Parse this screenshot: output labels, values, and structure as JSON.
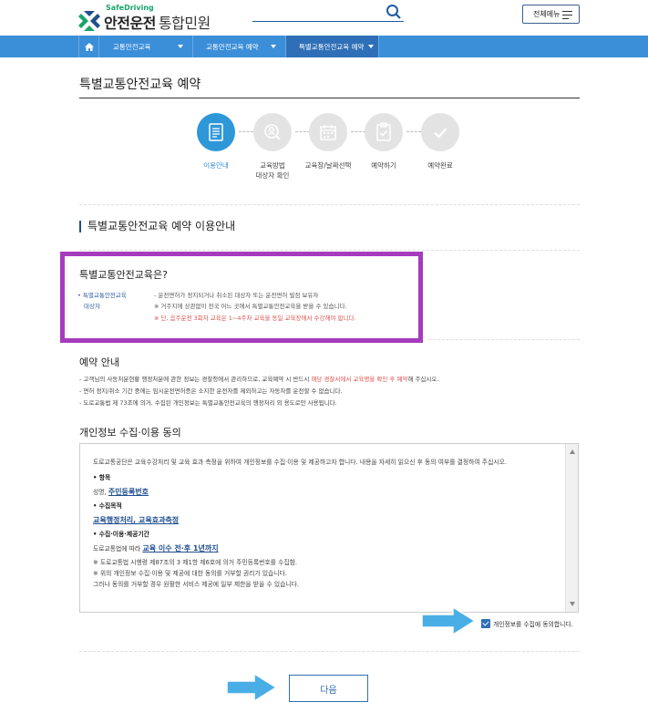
{
  "header": {
    "logo_en": "SafeDriving",
    "logo_ko": "안전운전",
    "logo_sub": "통합민원",
    "all_menu_label": "전체메뉴"
  },
  "nav": {
    "items": [
      {
        "label": "교통안전교육"
      },
      {
        "label": "교통안전교육 예약"
      },
      {
        "label": "특별교통안전교육 예약"
      }
    ]
  },
  "page": {
    "title": "특별교통안전교육 예약"
  },
  "steps": [
    {
      "label": "이용안내",
      "active": true,
      "icon": "document-icon"
    },
    {
      "label": "교육방법\n대상자 확인",
      "active": false,
      "icon": "user-search-icon"
    },
    {
      "label": "교육장/날짜선택",
      "active": false,
      "icon": "calendar-icon"
    },
    {
      "label": "예약하기",
      "active": false,
      "icon": "clipboard-check-icon"
    },
    {
      "label": "예약완료",
      "active": false,
      "icon": "check-icon"
    }
  ],
  "section": {
    "title": "특별교통안전교육 예약 이용안내"
  },
  "about": {
    "title": "특별교통안전교육은?",
    "key_line1": "• 특별교통안전교육",
    "key_line2": "대상자",
    "line1": "- 운전면허가 정지되거나 취소된 대상자 또는 운전면허 벌점 보유자",
    "line2": "※ 거주지에 상관없이 전국 어느 곳에서 특별교통안전교육을 받을 수 있습니다.",
    "line3": "※ 단, 음주운전 3회차 교육은 1~4주차 교육을 동일 교육장에서 수강해야 합니다."
  },
  "reservation": {
    "title": "예약 안내",
    "note1_a": "- 고객님의 사동처분현황 행정처분에 관한 정보는 경찰청에서 관리하므로, 교육예약 시 반드시 ",
    "note1_red": "해당 경찰서에서 교육명을 확인 후 예약",
    "note1_b": "해 주십시오.",
    "note2": "- 면허 정지/취소 기간 중에는 임시운전면허증은 소지한 운전자를 제외하고는 자동차를 운전할 수 없습니다.",
    "note3": "- 도로교통법 제 73조에 의거, 수집된 개인정보는 특별교통안전교육의 행정처리 외 용도로만 사용됩니다."
  },
  "privacy": {
    "title": "개인정보 수집·이용 동의",
    "intro": "도로교통공단은 교육수강처리 및 교육 효과 측정을 위하여 개인정보를 수집·이용 및 제공하고자 합니다. 내용을 자세히 읽으신 후 동의 여부를 결정하여 주십시오.",
    "item_label": "• 항목",
    "item_prefix": "성명, ",
    "item_value": "주민등록번호",
    "purpose_label": "• 수집목적",
    "purpose_value": "교육행정처리, 교육효과측정",
    "period_label": "• 수집·이용·제공기간",
    "period_prefix": "도로교통법에 따라 ",
    "period_value": "교육 이수 전·후 1년까지",
    "footnote1": "※ 도로교통법 시행령 제87조의 3 제1항 제6호에 의거 주민등록번호를 수집함.",
    "footnote2": "※ 위의 개인정보 수집·이용 및 제공에 대한 동의를 거부할 권리가 있습니다.",
    "footnote3": "그러나 동의를 거부할 경우 원활한 서비스 제공에 일부 제한을 받을 수 있습니다.",
    "agree_label": "개인정보를 수집에 동의합니다."
  },
  "actions": {
    "next_label": "다음"
  },
  "colors": {
    "brand_blue": "#3b8ed8",
    "active_step": "#2e97d8",
    "highlight": "#a53bbd",
    "arrow": "#4aaee6"
  }
}
